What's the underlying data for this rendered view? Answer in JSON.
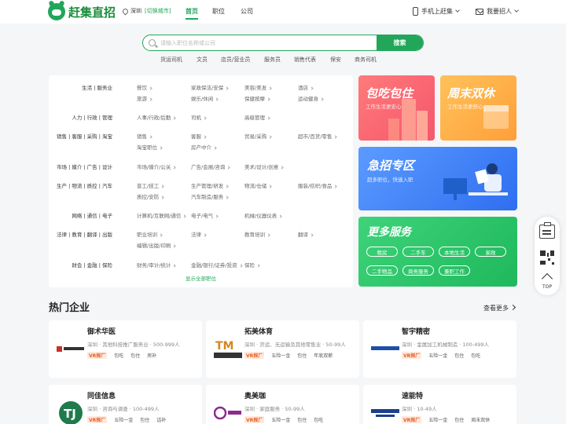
{
  "header": {
    "logo_text": "赶集直招",
    "city": "深圳",
    "city_switch": "[切换城市]",
    "nav": [
      "首页",
      "职位",
      "公司"
    ],
    "mobile": "手机上赶集",
    "recruit": "我要招人"
  },
  "search": {
    "placeholder": "请输入职位名称或公司",
    "button": "搜索",
    "hot": [
      "货运司机",
      "文员",
      "店员/营业员",
      "服务员",
      "销售代表",
      "保安",
      "商务司机"
    ]
  },
  "categories": {
    "rows": [
      {
        "name": "生活 | 服务业",
        "items": [
          "餐饮",
          "家政保洁/安保",
          "美容/美发",
          "酒店",
          "旅游",
          "娱乐/休闲",
          "保健按摩",
          "运动健身"
        ]
      },
      {
        "name": "人力 | 行政 | 管理",
        "items": [
          "人事/行政/后勤",
          "司机",
          "高级管理"
        ]
      },
      {
        "name": "销售 | 客服 | 采购 | 淘宝",
        "items": [
          "销售",
          "客服",
          "贸易/采购",
          "超市/百货/零售",
          "淘宝职位",
          "房产中介"
        ]
      },
      {
        "name": "市场 | 媒介 | 广告 | 设计",
        "items": [
          "市场/媒介/公关",
          "广告/会展/咨询",
          "美术/设计/创意"
        ]
      },
      {
        "name": "生产 | 物流 | 质控 | 汽车",
        "items": [
          "普工/技工",
          "生产管理/研发",
          "物流/仓储",
          "服装/纺织/食品",
          "质控/安防",
          "汽车制造/服务"
        ]
      },
      {
        "name": "网络 | 通信 | 电子",
        "items": [
          "计算机/互联网/通信",
          "电子/电气",
          "机械/仪器仪表"
        ]
      },
      {
        "name": "法律 | 教育 | 翻译 | 出版",
        "items": [
          "职业培训",
          "法律",
          "教育培训",
          "翻译",
          "编辑/出版/印刷"
        ]
      },
      {
        "name": "财会 | 金融 | 保险",
        "items": [
          "财务/审计/统计",
          "金融/银行/证券/投资",
          "保险"
        ]
      }
    ],
    "show_all": "显示全部职位"
  },
  "banners": {
    "b1": {
      "title": "包吃包住",
      "sub": "工作生活更安心"
    },
    "b2": {
      "title": "周末双休",
      "sub": "工作生活更舒心"
    },
    "b3": {
      "title": "急招专区",
      "sub": "超多职位，快速入职"
    },
    "b4": {
      "title": "更多服务",
      "buttons": [
        "租房",
        "二手车",
        "本地生活",
        "家政",
        "二手物品",
        "商务服务",
        "兼职工作"
      ]
    }
  },
  "side_tools": {
    "top": "TOP"
  },
  "companies": {
    "title": "热门企业",
    "more": "查看更多",
    "list": [
      {
        "name": "御术华医",
        "desc": "深圳 · 其他科技推广服务业 · 500-999人",
        "tags": [
          "VR探厂",
          "包吃",
          "包住",
          "房补"
        ]
      },
      {
        "name": "拓美体育",
        "desc": "深圳 · 货运、无运输及其他零售业 · 50-99人",
        "tags": [
          "VR探厂",
          "五险一金",
          "包住",
          "年底双薪"
        ]
      },
      {
        "name": "智宇精密",
        "desc": "深圳 · 金属加工机械制造 · 100-499人",
        "tags": [
          "VR探厂",
          "五险一金",
          "包住",
          "包吃"
        ]
      },
      {
        "name": "同佳信息",
        "desc": "深圳 · 咨询与调查 · 100-499人",
        "tags": [
          "VR探厂",
          "五险一金",
          "包住",
          "话补"
        ]
      },
      {
        "name": "奥美珈",
        "desc": "深圳 · 家庭服务 · 50-99人",
        "tags": [
          "VR探厂",
          "五险一金",
          "包住",
          "包吃"
        ]
      },
      {
        "name": "速能特",
        "desc": "深圳 · 10-49人",
        "tags": [
          "VR探厂",
          "五险一金",
          "包住",
          "周末双休"
        ]
      }
    ]
  },
  "colors": {
    "brand": "#21a65a",
    "banner_red": "#f5576c",
    "banner_orange": "#ffb347",
    "banner_blue": "#3d7ef5",
    "banner_green": "#22c363"
  }
}
